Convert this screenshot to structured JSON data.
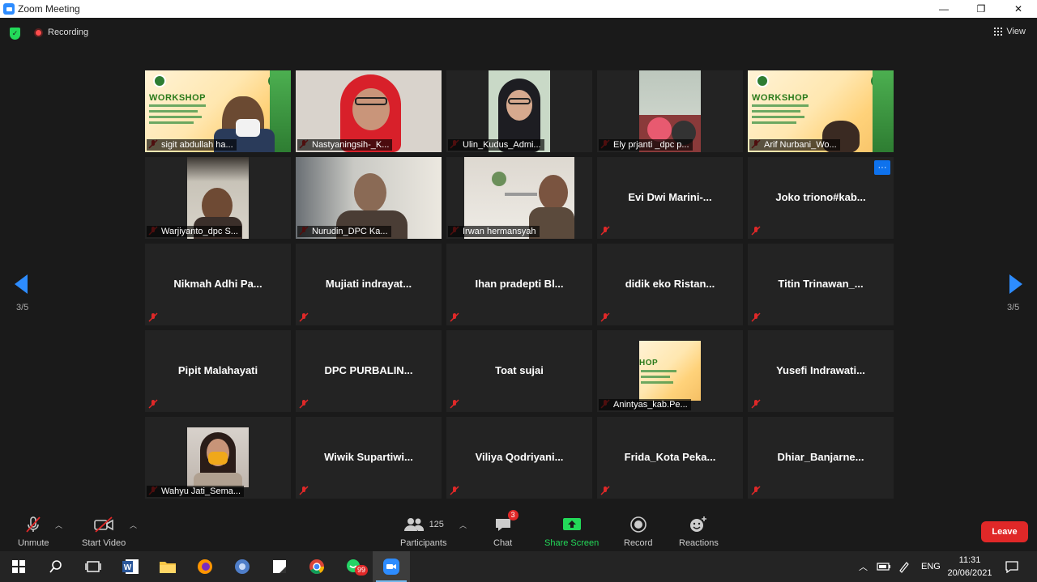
{
  "window": {
    "title": "Zoom Meeting",
    "minimize": "—",
    "restore": "❐",
    "close": "✕"
  },
  "topbar": {
    "recording": "Recording",
    "view": "View"
  },
  "nav": {
    "page_left": "3/5",
    "page_right": "3/5"
  },
  "tiles": [
    {
      "name": "sigit abdullah ha...",
      "video": true
    },
    {
      "name": "Nastyaningsih-_K...",
      "video": true
    },
    {
      "name": "Ulin_Kudus_Admi...",
      "video": true
    },
    {
      "name": "Ely prjanti _dpc p...",
      "video": true
    },
    {
      "name": "Arif Nurbani_Wo...",
      "video": true
    },
    {
      "name": "Warjiyanto_dpc S...",
      "video": true
    },
    {
      "name": "Nurudin_DPC Ka...",
      "video": true
    },
    {
      "name": "Irwan hermansyah",
      "video": true
    },
    {
      "name": "Evi  Dwi  Marini-...",
      "video": false
    },
    {
      "name": "Joko  triono#kab...",
      "video": false,
      "more": "···"
    },
    {
      "name": "Nikmah  Adhi  Pa...",
      "video": false
    },
    {
      "name": "Mujiati  indrayat...",
      "video": false
    },
    {
      "name": "Ihan  pradepti  Bl...",
      "video": false
    },
    {
      "name": "didik  eko  Ristan...",
      "video": false
    },
    {
      "name": "Titin  Trinawan_...",
      "video": false
    },
    {
      "name": "Pipit Malahayati",
      "video": false
    },
    {
      "name": "DPC  PURBALIN...",
      "video": false
    },
    {
      "name": "Toat sujai",
      "video": false
    },
    {
      "name": "Anintyas_kab.Pe...",
      "video": true
    },
    {
      "name": "Yusefi  Indrawati...",
      "video": false
    },
    {
      "name": "Wahyu Jati_Sema...",
      "video": true
    },
    {
      "name": "Wiwik  Supartiwi...",
      "video": false
    },
    {
      "name": "Viliya  Qodriyani...",
      "video": false
    },
    {
      "name": "Frida_Kota  Peka...",
      "video": false
    },
    {
      "name": "Dhiar_Banjarne...",
      "video": false
    }
  ],
  "toolbar": {
    "unmute": "Unmute",
    "start_video": "Start Video",
    "participants": "Participants",
    "participants_count": "125",
    "chat": "Chat",
    "chat_badge": "3",
    "share_screen": "Share Screen",
    "record": "Record",
    "reactions": "Reactions",
    "leave": "Leave"
  },
  "taskbar": {
    "whatsapp_badge": "99",
    "lang": "ENG",
    "time": "11:31",
    "date": "20/06/2021"
  },
  "colors": {
    "accent": "#2d8cff",
    "leave": "#e02828",
    "share": "#23d959"
  }
}
